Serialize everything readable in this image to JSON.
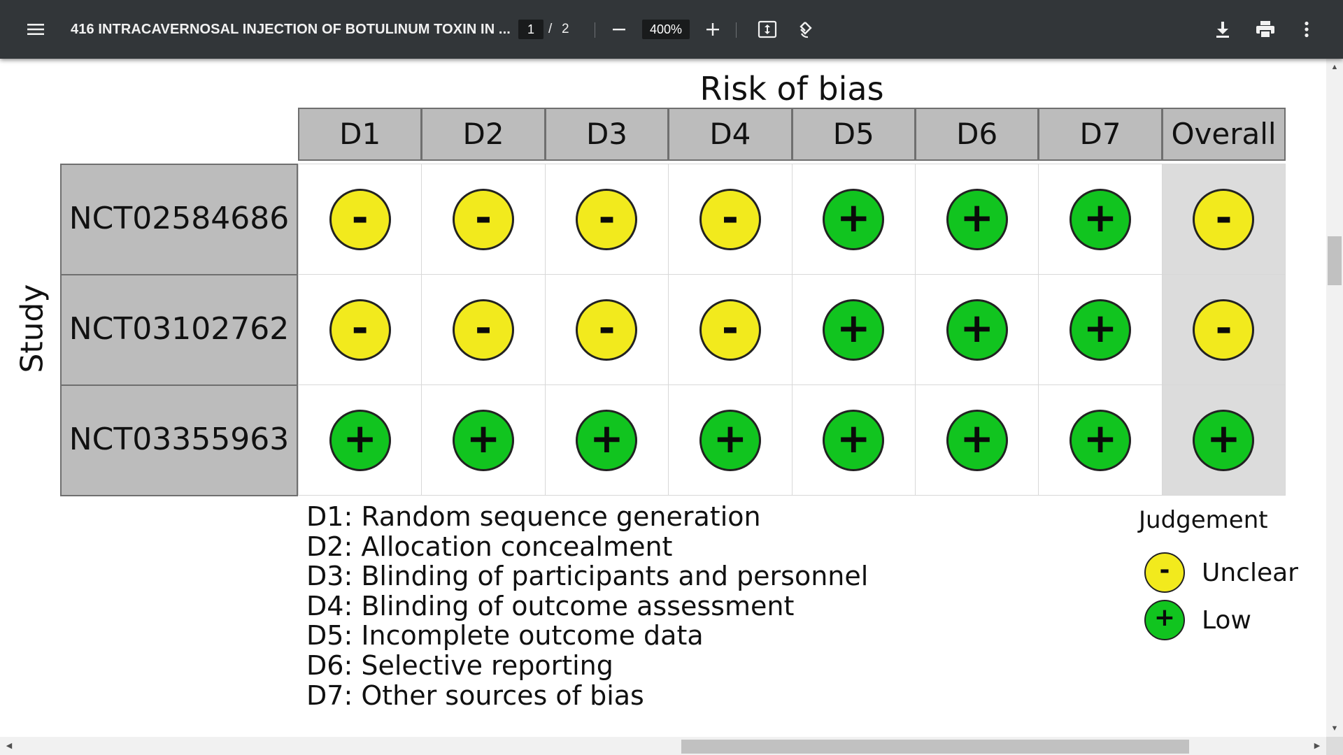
{
  "toolbar": {
    "title": "416 INTRACAVERNOSAL INJECTION OF BOTULINUM TOXIN IN ...",
    "current_page": "1",
    "page_separator": "/",
    "total_pages": "2",
    "zoom": "400%",
    "icons": {
      "menu": "hamburger-menu-icon",
      "zoom_out": "minus-icon",
      "zoom_in": "plus-icon",
      "fit": "fit-to-page-icon",
      "rotate": "rotate-counterclockwise-icon",
      "download": "download-icon",
      "print": "print-icon",
      "more": "more-vertical-icon"
    }
  },
  "figure": {
    "title": "Risk of bias",
    "y_axis_label": "Study",
    "columns": [
      "D1",
      "D2",
      "D3",
      "D4",
      "D5",
      "D6",
      "D7",
      "Overall"
    ],
    "rows": [
      {
        "study": "NCT02584686",
        "judgements": [
          "unclear",
          "unclear",
          "unclear",
          "unclear",
          "low",
          "low",
          "low",
          "unclear"
        ]
      },
      {
        "study": "NCT03102762",
        "judgements": [
          "unclear",
          "unclear",
          "unclear",
          "unclear",
          "low",
          "low",
          "low",
          "unclear"
        ]
      },
      {
        "study": "NCT03355963",
        "judgements": [
          "low",
          "low",
          "low",
          "low",
          "low",
          "low",
          "low",
          "low"
        ]
      }
    ],
    "symbols": {
      "unclear": "-",
      "low": "+"
    },
    "colors": {
      "unclear": "#f2ea1d",
      "low": "#11c41f",
      "header_bg": "#bcbcbc",
      "overall_bg": "#dcdcdc"
    },
    "domain_definitions": [
      "D1: Random sequence generation",
      "D2: Allocation concealment",
      "D3: Blinding of participants and personnel",
      "D4: Blinding of outcome assessment",
      "D5: Incomplete outcome data",
      "D6: Selective reporting",
      "D7: Other sources of bias"
    ],
    "legend": {
      "title": "Judgement",
      "items": [
        {
          "key": "unclear",
          "symbol": "-",
          "label": "Unclear"
        },
        {
          "key": "low",
          "symbol": "+",
          "label": "Low"
        }
      ]
    }
  }
}
